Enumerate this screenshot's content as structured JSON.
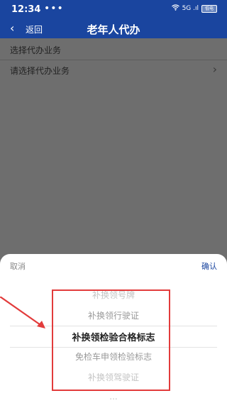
{
  "status_bar": {
    "time": "12:34",
    "dots": "•••",
    "signal": "5G .ıl",
    "battery": "低电",
    "wifi_icon": "wifi-icon"
  },
  "nav": {
    "back_icon": "chevron-left-icon",
    "back_label": "返回",
    "title": "老年人代办"
  },
  "form": {
    "section_label": "选择代办业务",
    "select_placeholder": "请选择代办业务"
  },
  "picker": {
    "cancel_label": "取消",
    "confirm_label": "确认",
    "options": [
      "补换领号牌",
      "补换领行驶证",
      "补换领检验合格标志",
      "免检车申领检验标志",
      "补换领驾驶证",
      "..."
    ],
    "selected_index": 2
  },
  "colors": {
    "primary": "#1a459f",
    "overlay_gray": "#6e6e6e",
    "annotation_red": "#e23b3b"
  }
}
